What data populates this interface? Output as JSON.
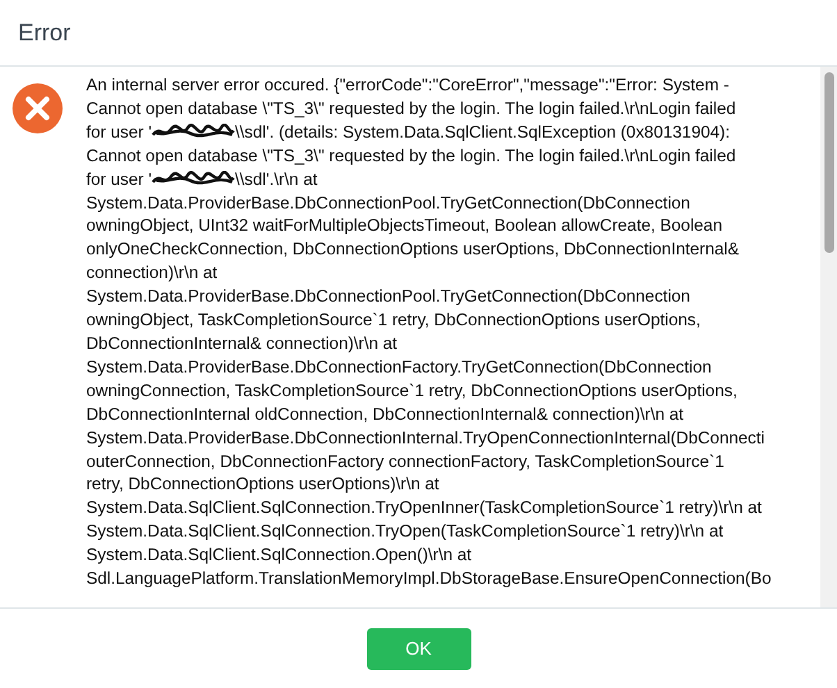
{
  "dialog": {
    "title": "Error",
    "kind": "error",
    "message_lines": [
      {
        "text": "An internal server error occured. {\"errorCode\":\"CoreError\",\"message\":\"Error: System -"
      },
      {
        "text": "Cannot open database \\\"TS_3\\\" requested by the login. The login failed.\\r\\nLogin failed"
      },
      {
        "text": "for user '",
        "redacted": true,
        "after": "\\\\sdl'. (details: System.Data.SqlClient.SqlException (0x80131904):"
      },
      {
        "text": "Cannot open database \\\"TS_3\\\" requested by the login. The login failed.\\r\\nLogin failed"
      },
      {
        "text": "for user '",
        "redacted": true,
        "after": "\\\\sdl'.\\r\\n at"
      },
      {
        "text": "System.Data.ProviderBase.DbConnectionPool.TryGetConnection(DbConnection"
      },
      {
        "text": "owningObject, UInt32 waitForMultipleObjectsTimeout, Boolean allowCreate, Boolean"
      },
      {
        "text": "onlyOneCheckConnection, DbConnectionOptions userOptions, DbConnectionInternal&"
      },
      {
        "text": "connection)\\r\\n at"
      },
      {
        "text": "System.Data.ProviderBase.DbConnectionPool.TryGetConnection(DbConnection"
      },
      {
        "text": "owningObject, TaskCompletionSource`1 retry, DbConnectionOptions userOptions,"
      },
      {
        "text": "DbConnectionInternal& connection)\\r\\n at"
      },
      {
        "text": "System.Data.ProviderBase.DbConnectionFactory.TryGetConnection(DbConnection"
      },
      {
        "text": "owningConnection, TaskCompletionSource`1 retry, DbConnectionOptions userOptions,"
      },
      {
        "text": "DbConnectionInternal oldConnection, DbConnectionInternal& connection)\\r\\n at"
      },
      {
        "text": "System.Data.ProviderBase.DbConnectionInternal.TryOpenConnectionInternal(DbConnecti"
      },
      {
        "text": "outerConnection, DbConnectionFactory connectionFactory, TaskCompletionSource`1"
      },
      {
        "text": "retry, DbConnectionOptions userOptions)\\r\\n at"
      },
      {
        "text": "System.Data.SqlClient.SqlConnection.TryOpenInner(TaskCompletionSource`1 retry)\\r\\n at"
      },
      {
        "text": "System.Data.SqlClient.SqlConnection.TryOpen(TaskCompletionSource`1 retry)\\r\\n at"
      },
      {
        "text": "System.Data.SqlClient.SqlConnection.Open()\\r\\n at"
      },
      {
        "text": "Sdl.LanguagePlatform.TranslationMemoryImpl.DbStorageBase.EnsureOpenConnection(Bo"
      }
    ],
    "buttons": [
      {
        "label": "OK",
        "kind": "primary"
      }
    ]
  }
}
